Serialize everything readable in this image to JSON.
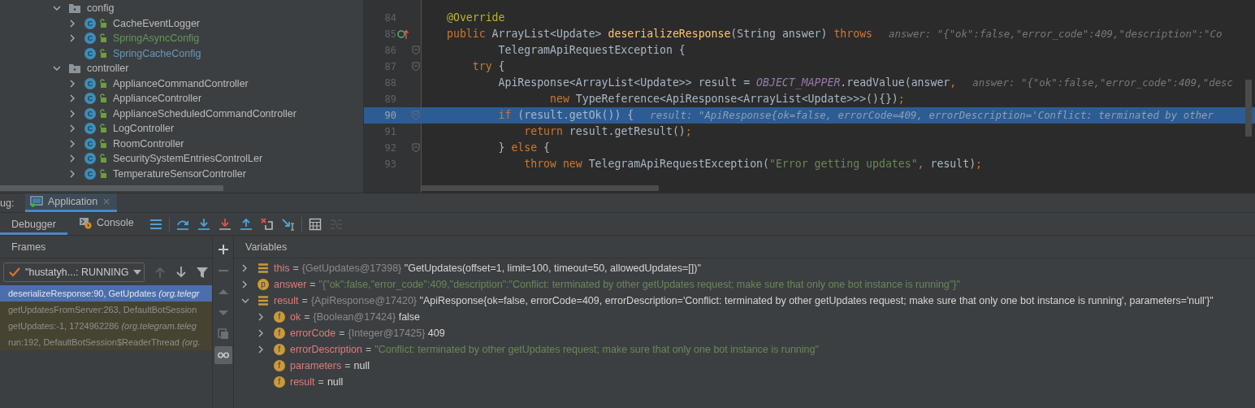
{
  "project_tree": {
    "items": [
      {
        "label": "config",
        "kind": "folder",
        "expandable": true,
        "expanded": true,
        "color": "#bbbbbb",
        "children": [
          {
            "label": "CacheEventLogger",
            "kind": "class",
            "badge": "C",
            "expandable": true,
            "expanded": false,
            "color": "#bbbbbb"
          },
          {
            "label": "SpringAsyncConfig",
            "kind": "class",
            "badge": "C",
            "expandable": true,
            "expanded": false,
            "color": "#629755"
          },
          {
            "label": "SpringCacheConfig",
            "kind": "class",
            "badge": "C",
            "expandable": false,
            "color": "#6897bb"
          }
        ]
      },
      {
        "label": "controller",
        "kind": "folder",
        "expandable": true,
        "expanded": true,
        "color": "#bbbbbb",
        "children": [
          {
            "label": "ApplianceCommandController",
            "kind": "class",
            "badge": "C",
            "expandable": true,
            "expanded": false,
            "color": "#bbbbbb"
          },
          {
            "label": "ApplianceController",
            "kind": "class",
            "badge": "C",
            "expandable": true,
            "expanded": false,
            "color": "#bbbbbb"
          },
          {
            "label": "ApplianceScheduledCommandController",
            "kind": "class",
            "badge": "C",
            "expandable": true,
            "expanded": false,
            "color": "#bbbbbb"
          },
          {
            "label": "LogController",
            "kind": "class",
            "badge": "C",
            "expandable": true,
            "expanded": false,
            "color": "#bbbbbb"
          },
          {
            "label": "RoomController",
            "kind": "class",
            "badge": "C",
            "expandable": true,
            "expanded": false,
            "color": "#bbbbbb"
          },
          {
            "label": "SecuritySystemEntriesControlLer",
            "kind": "class",
            "badge": "C",
            "expandable": true,
            "expanded": false,
            "color": "#bbbbbb"
          },
          {
            "label": "TemperatureSensorController",
            "kind": "class",
            "badge": "C",
            "expandable": true,
            "expanded": false,
            "color": "#bbbbbb"
          }
        ]
      }
    ]
  },
  "editor": {
    "lines": [
      {
        "number": "84",
        "selected": false,
        "fold": false,
        "marker": false,
        "tokens": [
          {
            "kind": "annotation",
            "text": "@Override"
          }
        ]
      },
      {
        "number": "85",
        "selected": false,
        "fold": false,
        "marker": true,
        "tokens": [
          {
            "kind": "keyword",
            "text": "public"
          },
          {
            "kind": "plain",
            "text": " ArrayList<Update> "
          },
          {
            "kind": "method",
            "text": "deserializeResponse"
          },
          {
            "kind": "plain",
            "text": "(String answer) "
          },
          {
            "kind": "keyword",
            "text": "throws"
          },
          {
            "kind": "hint",
            "text": "answer: \"{\"ok\":false,\"error_code\":409,\"description\":\"Co"
          }
        ]
      },
      {
        "number": "86",
        "selected": false,
        "fold": true,
        "marker": false,
        "tokens": [
          {
            "kind": "plain",
            "text": "        TelegramApiRequestException {"
          }
        ]
      },
      {
        "number": "87",
        "selected": false,
        "fold": true,
        "marker": false,
        "tokens": [
          {
            "kind": "keyword",
            "text": "    try"
          },
          {
            "kind": "plain",
            "text": " {"
          }
        ]
      },
      {
        "number": "88",
        "selected": false,
        "fold": false,
        "marker": false,
        "tokens": [
          {
            "kind": "plain",
            "text": "        ApiResponse<ArrayList<Update>> result = "
          },
          {
            "kind": "constant",
            "text": "OBJECT_MAPPER"
          },
          {
            "kind": "plain",
            "text": ".readValue(answer"
          },
          {
            "kind": "keyword",
            "text": ","
          },
          {
            "kind": "hint",
            "text": "answer: \"{\"ok\":false,\"error_code\":409,\"desc"
          }
        ]
      },
      {
        "number": "89",
        "selected": false,
        "fold": false,
        "marker": false,
        "tokens": [
          {
            "kind": "keyword",
            "text": "                new"
          },
          {
            "kind": "plain",
            "text": " TypeReference<ApiResponse<ArrayList<Update>>>(){})"
          },
          {
            "kind": "keyword",
            "text": ";"
          }
        ]
      },
      {
        "number": "90",
        "selected": true,
        "fold": true,
        "marker": false,
        "tokens": [
          {
            "kind": "keyword",
            "text": "        if"
          },
          {
            "kind": "plain",
            "text": " (result.getOk()) {"
          },
          {
            "kind": "hint",
            "text": "result: \"ApiResponse{ok=false, errorCode=409, errorDescription='Conflict: terminated by other"
          }
        ]
      },
      {
        "number": "91",
        "selected": false,
        "fold": false,
        "marker": false,
        "tokens": [
          {
            "kind": "keyword",
            "text": "            return"
          },
          {
            "kind": "plain",
            "text": " result.getResult()"
          },
          {
            "kind": "keyword",
            "text": ";"
          }
        ]
      },
      {
        "number": "92",
        "selected": false,
        "fold": true,
        "marker": false,
        "tokens": [
          {
            "kind": "plain",
            "text": "        } "
          },
          {
            "kind": "keyword",
            "text": "else"
          },
          {
            "kind": "plain",
            "text": " {"
          }
        ]
      },
      {
        "number": "93",
        "selected": false,
        "fold": false,
        "marker": false,
        "tokens": [
          {
            "kind": "keyword",
            "text": "            throw new"
          },
          {
            "kind": "plain",
            "text": " TelegramApiRequestException("
          },
          {
            "kind": "string",
            "text": "\"Error getting updates\""
          },
          {
            "kind": "keyword",
            "text": ","
          },
          {
            "kind": "plain",
            "text": " result)"
          },
          {
            "kind": "keyword",
            "text": ";"
          }
        ]
      }
    ]
  },
  "debug_bar": {
    "label": "ug:",
    "tabs": [
      {
        "label": "Application",
        "selected": true
      }
    ]
  },
  "debug_toolbar": {
    "tabs": [
      {
        "label": "Debugger",
        "kind": "debugger",
        "selected": true
      },
      {
        "label": "Console",
        "kind": "console",
        "selected": false
      }
    ],
    "buttons": [
      {
        "kind": "threads",
        "disabled": false
      },
      {
        "kind": "step-over",
        "disabled": false
      },
      {
        "kind": "step-into",
        "disabled": false
      },
      {
        "kind": "force-step-into",
        "disabled": false
      },
      {
        "kind": "step-out",
        "disabled": false
      },
      {
        "kind": "drop-frame",
        "disabled": false
      },
      {
        "kind": "run-to-cursor",
        "disabled": false
      },
      {
        "kind": "evaluate",
        "disabled": false
      },
      {
        "kind": "trace",
        "disabled": true
      }
    ]
  },
  "frames": {
    "title": "Frames",
    "thread": "\"hustatyh...: RUNNING",
    "nav": [
      {
        "kind": "up",
        "disabled": true
      },
      {
        "kind": "down",
        "disabled": false
      },
      {
        "kind": "filter",
        "disabled": false
      }
    ],
    "items": [
      {
        "text": "deserializeResponse:90, GetUpdates *(org.telegr*",
        "kind": "app",
        "selected": true
      },
      {
        "text": "getUpdatesFromServer:263, DefaultBotSession",
        "kind": "library",
        "selected": false
      },
      {
        "text": "getUpdates:-1, 1724962286 *(org.telegram.teleg*",
        "kind": "library",
        "selected": false
      },
      {
        "text": "run:192, DefaultBotSession$ReaderThread *(org.*",
        "kind": "library",
        "selected": false
      }
    ]
  },
  "side_tools": [
    {
      "kind": "add",
      "disabled": false,
      "selected": false
    },
    {
      "kind": "remove",
      "disabled": true,
      "selected": false
    },
    {
      "kind": "up",
      "disabled": true,
      "selected": false
    },
    {
      "kind": "down",
      "disabled": true,
      "selected": false
    },
    {
      "kind": "copy",
      "disabled": true,
      "selected": false
    },
    {
      "kind": "watches",
      "disabled": false,
      "selected": true
    }
  ],
  "variables": {
    "title": "Variables",
    "items": [
      {
        "name": "this",
        "kind": "local",
        "expandable": true,
        "expanded": false,
        "separator": "=",
        "ref": "{GetUpdates@17398}",
        "value": "\"GetUpdates(offset=1, limit=100, timeout=50, allowedUpdates=[])\"",
        "is_string": false
      },
      {
        "name": "answer",
        "kind": "param",
        "badge": "p",
        "expandable": true,
        "expanded": false,
        "separator": "=",
        "value": "\"{\"ok\":false,\"error_code\":409,\"description\":\"Conflict: terminated by other getUpdates request; make sure that only one bot instance is running\"}\"",
        "is_string": true
      },
      {
        "name": "result",
        "kind": "local",
        "expandable": true,
        "expanded": true,
        "separator": "=",
        "ref": "{ApiResponse@17420}",
        "value": "\"ApiResponse{ok=false, errorCode=409, errorDescription='Conflict: terminated by other getUpdates request; make sure that only one bot instance is running', parameters='null'}\"",
        "is_string": false,
        "children": [
          {
            "name": "ok",
            "kind": "field",
            "badge": "f",
            "expandable": true,
            "expanded": false,
            "separator": "=",
            "ref": "{Boolean@17424}",
            "value": "false",
            "is_string": false
          },
          {
            "name": "errorCode",
            "kind": "field",
            "badge": "f",
            "expandable": true,
            "expanded": false,
            "separator": "=",
            "ref": "{Integer@17425}",
            "value": "409",
            "is_string": false
          },
          {
            "name": "errorDescription",
            "kind": "field",
            "badge": "f",
            "expandable": true,
            "expanded": false,
            "separator": "=",
            "value": "\"Conflict: terminated by other getUpdates request; make sure that only one bot instance is running\"",
            "is_string": true
          },
          {
            "name": "parameters",
            "kind": "field",
            "badge": "f",
            "expandable": false,
            "separator": "=",
            "value": "null",
            "is_string": false
          },
          {
            "name": "result",
            "kind": "field",
            "badge": "f",
            "expandable": false,
            "separator": "=",
            "value": "null",
            "is_string": false
          }
        ]
      }
    ]
  }
}
